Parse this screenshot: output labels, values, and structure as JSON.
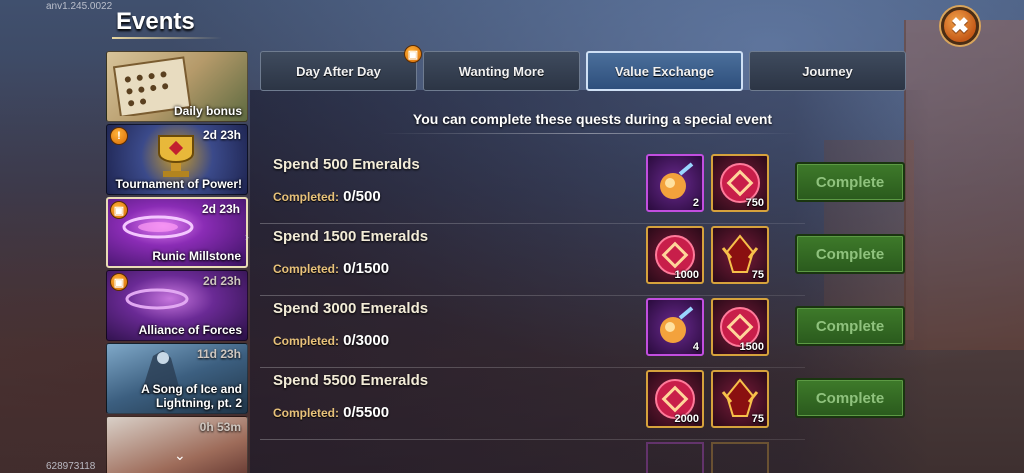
{
  "version": "anv1.245.0022",
  "build_id": "628973118",
  "title": "Events",
  "close_icon": "✖",
  "sidebar": {
    "items": [
      {
        "label": "Daily bonus",
        "timer": ""
      },
      {
        "label": "Tournament of Power!",
        "timer": "2d 23h",
        "badge": "!"
      },
      {
        "label": "Runic Millstone",
        "timer": "2d 23h",
        "badge": "gift"
      },
      {
        "label": "Alliance of Forces",
        "timer": "2d 23h",
        "badge": "gift"
      },
      {
        "label": "A Song of Ice and Lightning, pt. 2",
        "timer": "11d 23h"
      },
      {
        "label": "",
        "timer": "0h 53m"
      }
    ],
    "selected_index": 2
  },
  "tabs": [
    {
      "label": "Day After Day"
    },
    {
      "label": "Wanting More"
    },
    {
      "label": "Value Exchange",
      "active": true
    },
    {
      "label": "Journey"
    }
  ],
  "subtitle": "You can complete these quests during a special event",
  "quests": [
    {
      "title": "Spend 500 Emeralds",
      "progress_label": "Completed:",
      "progress": "0/500",
      "rewards": [
        {
          "icon": "potion-icon",
          "count": "2"
        },
        {
          "icon": "coin-icon",
          "count": "750"
        }
      ],
      "button": "Complete"
    },
    {
      "title": "Spend 1500 Emeralds",
      "progress_label": "Completed:",
      "progress": "0/1500",
      "rewards": [
        {
          "icon": "coin-icon",
          "count": "1000"
        },
        {
          "icon": "crystal-icon",
          "count": "75"
        }
      ],
      "button": "Complete"
    },
    {
      "title": "Spend 3000 Emeralds",
      "progress_label": "Completed:",
      "progress": "0/3000",
      "rewards": [
        {
          "icon": "potion-icon",
          "count": "4"
        },
        {
          "icon": "coin-icon",
          "count": "1500"
        }
      ],
      "button": "Complete"
    },
    {
      "title": "Spend 5500 Emeralds",
      "progress_label": "Completed:",
      "progress": "0/5500",
      "rewards": [
        {
          "icon": "coin-icon",
          "count": "2000"
        },
        {
          "icon": "crystal-icon",
          "count": "75"
        }
      ],
      "button": "Complete"
    }
  ]
}
